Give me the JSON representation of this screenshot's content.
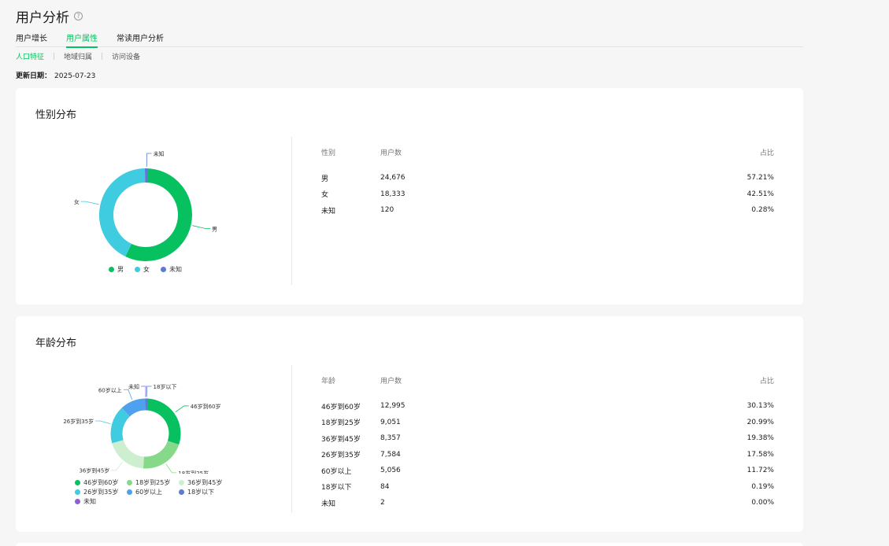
{
  "page": {
    "title": "用户分析",
    "help_icon": "?"
  },
  "main_tabs": [
    {
      "label": "用户增长"
    },
    {
      "label": "用户属性"
    },
    {
      "label": "常读用户分析"
    }
  ],
  "sub_tabs": [
    {
      "label": "人口特征"
    },
    {
      "label": "地域归属"
    },
    {
      "label": "访问设备"
    }
  ],
  "update": {
    "label": "更新日期：",
    "value": "2025-07-23"
  },
  "gender": {
    "title": "性别分布",
    "headers": [
      "性别",
      "用户数",
      "占比"
    ],
    "rows": [
      {
        "name": "男",
        "count": "24,676",
        "pct": "57.21%"
      },
      {
        "name": "女",
        "count": "18,333",
        "pct": "42.51%"
      },
      {
        "name": "未知",
        "count": "120",
        "pct": "0.28%"
      }
    ],
    "legend": [
      "男",
      "女",
      "未知"
    ]
  },
  "age": {
    "title": "年龄分布",
    "headers": [
      "年龄",
      "用户数",
      "占比"
    ],
    "rows": [
      {
        "name": "46岁到60岁",
        "count": "12,995",
        "pct": "30.13%"
      },
      {
        "name": "18岁到25岁",
        "count": "9,051",
        "pct": "20.99%"
      },
      {
        "name": "36岁到45岁",
        "count": "8,357",
        "pct": "19.38%"
      },
      {
        "name": "26岁到35岁",
        "count": "7,584",
        "pct": "17.58%"
      },
      {
        "name": "60岁以上",
        "count": "5,056",
        "pct": "11.72%"
      },
      {
        "name": "18岁以下",
        "count": "84",
        "pct": "0.19%"
      },
      {
        "name": "未知",
        "count": "2",
        "pct": "0.00%"
      }
    ],
    "legend": [
      "46岁到60岁",
      "18岁到25岁",
      "36岁到45岁",
      "26岁到35岁",
      "60岁以上",
      "18岁以下",
      "未知"
    ]
  },
  "chart_data": [
    {
      "type": "pie",
      "categories": [
        "男",
        "女",
        "未知"
      ],
      "values": [
        57.21,
        42.51,
        0.28
      ],
      "colors": [
        "#07c160",
        "#3fcbe0",
        "#5b7bd5"
      ]
    },
    {
      "type": "pie",
      "categories": [
        "46岁到60岁",
        "18岁到25岁",
        "36岁到45岁",
        "26岁到35岁",
        "60岁以上",
        "18岁以下",
        "未知"
      ],
      "values": [
        30.13,
        20.99,
        19.38,
        17.58,
        11.72,
        0.19,
        0.0
      ],
      "colors": [
        "#07c160",
        "#86d989",
        "#cdefd0",
        "#3fcbe0",
        "#4ea1ee",
        "#5b7bd5",
        "#8e5fd4"
      ]
    }
  ]
}
